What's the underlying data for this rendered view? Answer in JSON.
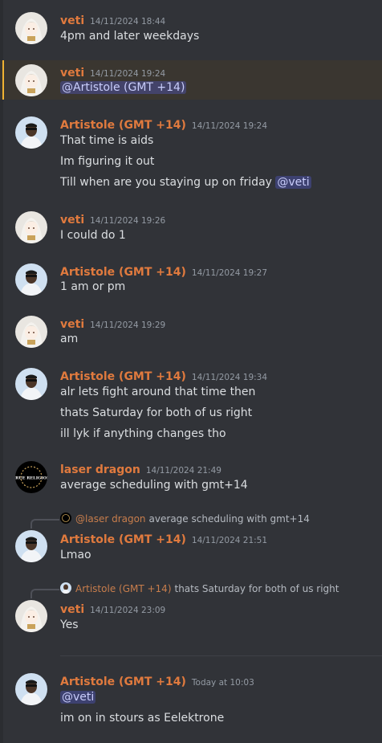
{
  "colors": {
    "veti": "#e07a3e",
    "artistole": "#e07a3e",
    "laser": "#e07a3e",
    "mention_bg": "#5865f2",
    "highlight_bar": "#f0b232"
  },
  "messages": [
    {
      "author": "veti",
      "timestamp": "14/11/2024 18:44",
      "lines": [
        "4pm and later weekdays"
      ]
    },
    {
      "author": "veti",
      "timestamp": "14/11/2024 19:24",
      "mention": "@Artistole (GMT +14)"
    },
    {
      "author": "Artistole (GMT +14)",
      "timestamp": "14/11/2024 19:24",
      "lines": [
        "That time is aids",
        "Im figuring it out",
        "Till when are you staying up on friday"
      ],
      "mention": "@veti"
    },
    {
      "author": "veti",
      "timestamp": "14/11/2024 19:26",
      "lines": [
        "I could do 1"
      ]
    },
    {
      "author": "Artistole (GMT +14)",
      "timestamp": "14/11/2024 19:27",
      "lines": [
        "1 am or pm"
      ]
    },
    {
      "author": "veti",
      "timestamp": "14/11/2024 19:29",
      "lines": [
        "am"
      ]
    },
    {
      "author": "Artistole (GMT +14)",
      "timestamp": "14/11/2024 19:34",
      "lines": [
        "alr lets fight around that time then",
        "thats Saturday for both of us right",
        "ill lyk if anything changes tho"
      ]
    },
    {
      "author": "laser dragon",
      "timestamp": "14/11/2024 21:49",
      "lines": [
        "average scheduling with gmt+14"
      ]
    },
    {
      "author": "Artistole (GMT +14)",
      "timestamp": "14/11/2024 21:51",
      "lines": [
        "Lmao"
      ],
      "reply": {
        "name": "@laser dragon",
        "text": "average scheduling with gmt+14"
      }
    },
    {
      "author": "veti",
      "timestamp": "14/11/2024 23:09",
      "lines": [
        "Yes"
      ],
      "reply": {
        "name": "Artistole (GMT +14)",
        "text": "thats Saturday for both of us right"
      }
    },
    {
      "author": "Artistole (GMT +14)",
      "timestamp": "Today at 10:03",
      "mention": "@veti",
      "lines": [
        "im on in stours as Eelektrone"
      ]
    }
  ],
  "icons": {
    "avatar_veti": "anime-girl-avatar",
    "avatar_artistole": "man-sunglasses-avatar",
    "avatar_laser": "true-religion-logo-avatar"
  },
  "logo_text": "TRUE RELIGION"
}
